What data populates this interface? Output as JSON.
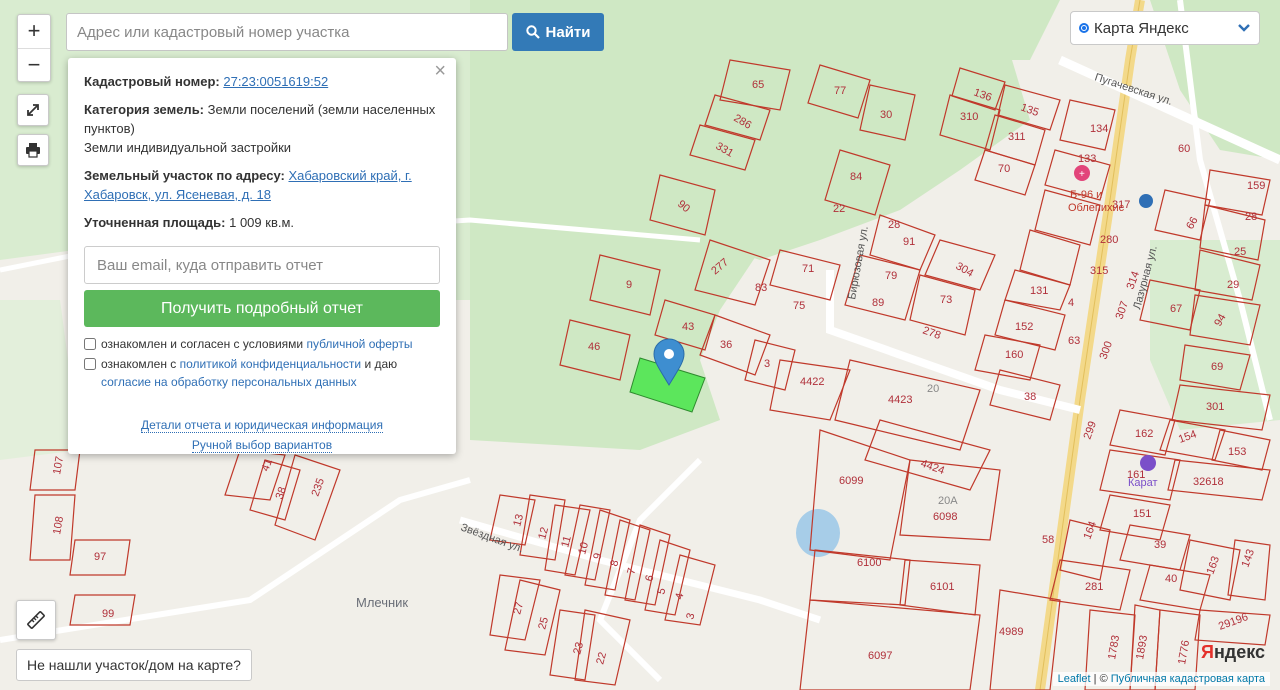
{
  "search": {
    "placeholder": "Адрес или кадастровый номер участка",
    "button_label": "Найти",
    "icon": "search-icon"
  },
  "zoom": {
    "in_label": "+",
    "out_label": "−"
  },
  "layer_selector": {
    "selected": "Карта Яндекс",
    "icon": "chevron-down-icon"
  },
  "popup": {
    "cadastral_label": "Кадастровый номер:",
    "cadastral_number": "27:23:0051619:52",
    "category_label": "Категория земель:",
    "category_value": "Земли поселений (земли населенных пунктов)",
    "usage_value": "Земли индивидуальной застройки",
    "address_label": "Земельный участок по адресу:",
    "address_value": "Хабаровский край, г. Хабаровск, ул. Ясеневая, д. 18",
    "area_label": "Уточненная площадь:",
    "area_value": "1 009 кв.м.",
    "email_placeholder": "Ваш email, куда отправить отчет",
    "report_button": "Получить подробный отчет",
    "consent1_prefix": "ознакомлен и согласен с условиями",
    "consent1_link": "публичной оферты",
    "consent2_prefix": "ознакомлен с",
    "consent2_link1": "политикой конфиденциальности",
    "consent2_middle": "и даю",
    "consent2_link2": "согласие на обработку персональных данных",
    "details_link": "Детали отчета и юридическая информация",
    "manual_link": "Ручной выбор вариантов",
    "close_label": "×"
  },
  "map": {
    "streets": [
      "Пугачевская ул.",
      "Бирюзовая ул.",
      "Лазурная ул.",
      "Звёздная ул."
    ],
    "place": "Млечник",
    "poi": [
      "Б-96 и Облепихис",
      "Карат"
    ],
    "parcels": [
      "65",
      "77",
      "286",
      "30",
      "331",
      "136",
      "135",
      "310",
      "311",
      "70",
      "134",
      "133",
      "60",
      "159",
      "84",
      "22",
      "90",
      "317",
      "280",
      "28",
      "91",
      "304",
      "28",
      "315",
      "66",
      "25",
      "9",
      "277",
      "71",
      "79",
      "83",
      "73",
      "89",
      "131",
      "4",
      "29",
      "67",
      "75",
      "278",
      "152",
      "63",
      "94",
      "46",
      "43",
      "36",
      "3",
      "4422",
      "160",
      "300",
      "69",
      "4423",
      "20",
      "38",
      "301",
      "162",
      "154",
      "153",
      "4424",
      "161",
      "32618",
      "6099",
      "20А",
      "6098",
      "151",
      "39",
      "58",
      "164",
      "143",
      "6100",
      "6101",
      "281",
      "40",
      "163",
      "4989",
      "6097",
      "1783",
      "1893",
      "1776",
      "29196",
      "107",
      "108",
      "97",
      "99",
      "41",
      "38",
      "235",
      "13",
      "12",
      "11",
      "10",
      "9",
      "8",
      "7",
      "6",
      "5",
      "4",
      "3",
      "27",
      "25",
      "23",
      "22",
      "299",
      "307",
      "314"
    ]
  },
  "map_controls": {
    "fullscreen_icon": "expand-icon",
    "print_icon": "printer-icon",
    "ruler_icon": "ruler-icon"
  },
  "not_found_label": "Не нашли участок/дом на карте?",
  "attribution": {
    "leaflet": "Leaflet",
    "separator": " | © ",
    "source": "Публичная кадастровая карта"
  },
  "yandex_logo": {
    "first": "Я",
    "rest": "ндекс"
  },
  "colors": {
    "accent": "#337ab7",
    "report_button": "#5cb85c",
    "parcel_border": "#c0392b",
    "selected_parcel": "#5ce65c",
    "forest": "#cfe8c4"
  }
}
